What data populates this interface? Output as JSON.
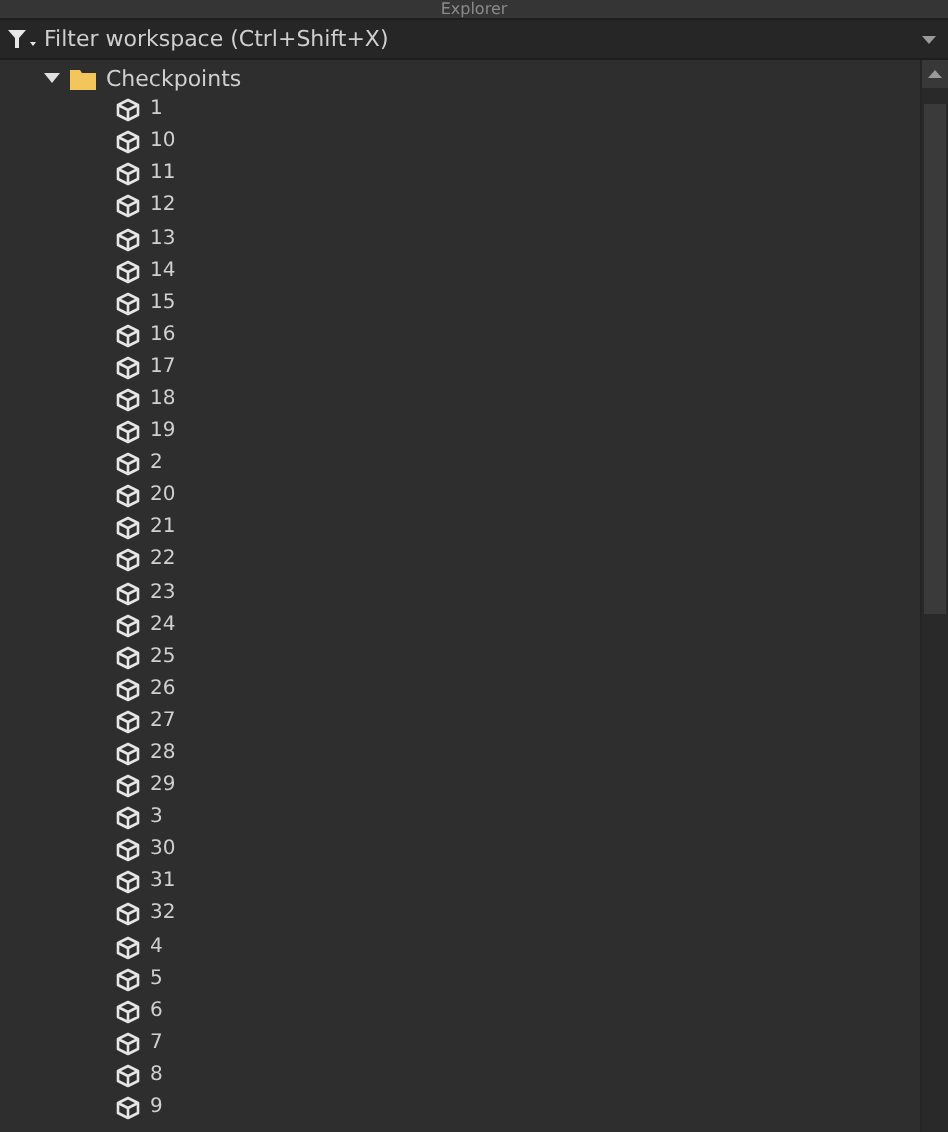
{
  "window": {
    "title": "Explorer"
  },
  "filter": {
    "placeholder": "Filter workspace (Ctrl+Shift+X)"
  },
  "tree": [
    {
      "name": "Checkpoints",
      "kind": "folder",
      "expanded": true,
      "children": [
        {
          "name": "1",
          "kind": "part"
        },
        {
          "name": "10",
          "kind": "part"
        },
        {
          "name": "11",
          "kind": "part"
        },
        {
          "name": "12",
          "kind": "part"
        },
        {
          "name": "13",
          "kind": "part"
        },
        {
          "name": "14",
          "kind": "part"
        },
        {
          "name": "15",
          "kind": "part"
        },
        {
          "name": "16",
          "kind": "part"
        },
        {
          "name": "17",
          "kind": "part"
        },
        {
          "name": "18",
          "kind": "part"
        },
        {
          "name": "19",
          "kind": "part"
        },
        {
          "name": "2",
          "kind": "part"
        },
        {
          "name": "20",
          "kind": "part"
        },
        {
          "name": "21",
          "kind": "part"
        },
        {
          "name": "22",
          "kind": "part"
        },
        {
          "name": "23",
          "kind": "part"
        },
        {
          "name": "24",
          "kind": "part"
        },
        {
          "name": "25",
          "kind": "part"
        },
        {
          "name": "26",
          "kind": "part"
        },
        {
          "name": "27",
          "kind": "part"
        },
        {
          "name": "28",
          "kind": "part"
        },
        {
          "name": "29",
          "kind": "part"
        },
        {
          "name": "3",
          "kind": "part"
        },
        {
          "name": "30",
          "kind": "part"
        },
        {
          "name": "31",
          "kind": "part"
        },
        {
          "name": "32",
          "kind": "part"
        },
        {
          "name": "4",
          "kind": "part"
        },
        {
          "name": "5",
          "kind": "part"
        },
        {
          "name": "6",
          "kind": "part"
        },
        {
          "name": "7",
          "kind": "part"
        },
        {
          "name": "8",
          "kind": "part"
        },
        {
          "name": "9",
          "kind": "part"
        }
      ]
    }
  ]
}
